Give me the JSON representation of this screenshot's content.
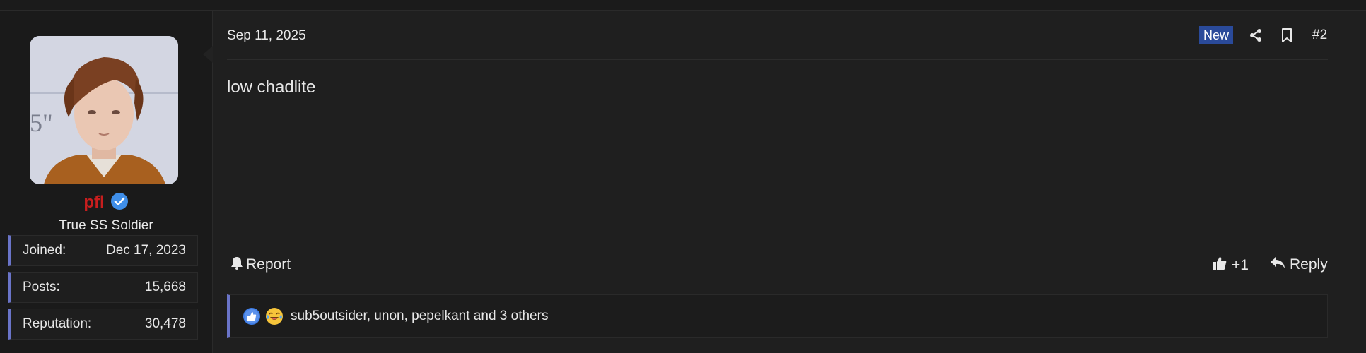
{
  "user": {
    "name": "pfl",
    "title": "True SS Soldier",
    "stats": [
      {
        "label": "Joined:",
        "value": "Dec 17, 2023"
      },
      {
        "label": "Posts:",
        "value": "15,668"
      },
      {
        "label": "Reputation:",
        "value": "30,478"
      }
    ],
    "name_color": "#c81e1e"
  },
  "post": {
    "date": "Sep 11, 2025",
    "new_badge": "New",
    "number": "#2",
    "message": "low chadlite",
    "actions": {
      "report": "Report",
      "like": "+1",
      "reply": "Reply"
    },
    "reactions_text": "sub5outsider, unon, pepelkant and 3 others"
  },
  "icons": {
    "verified": "verified-check-icon",
    "share": "share-icon",
    "bookmark": "bookmark-icon",
    "bell": "bell-icon",
    "thumbs_up": "thumbs-up-icon",
    "reply": "reply-arrow-icon",
    "like_reaction": "like-reaction-icon",
    "laugh_cry_reaction": "laugh-cry-emoji-icon"
  },
  "colors": {
    "accent": "#6a74c8",
    "badge_bg": "#2a4a9a",
    "verified": "#3f8ee8"
  }
}
